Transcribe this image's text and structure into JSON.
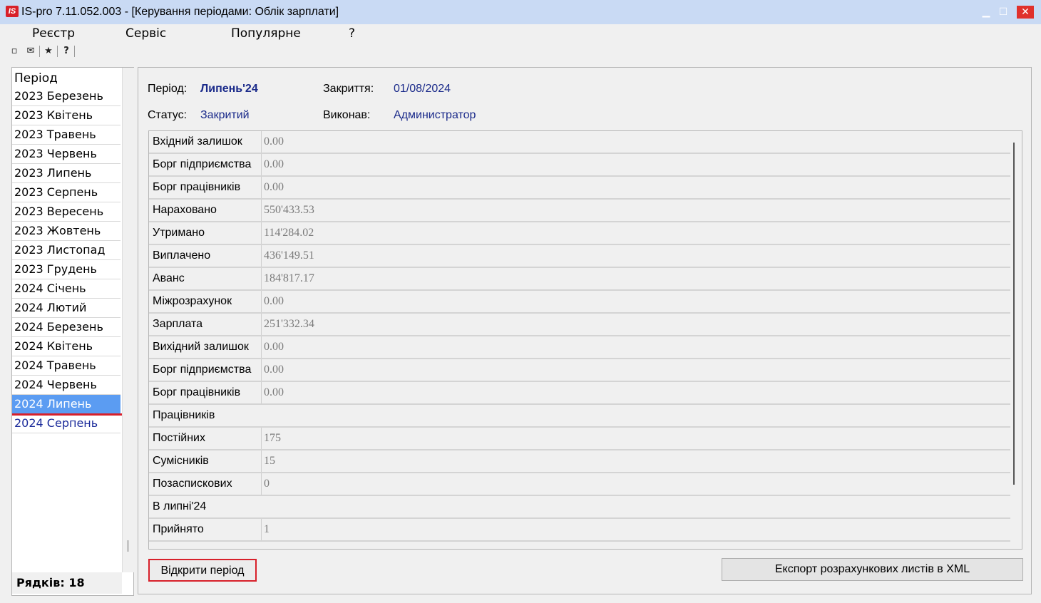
{
  "window": {
    "logo": "IS",
    "title": "IS-pro 7.11.052.003 - [Керування періодами: Облік зарплати]",
    "minimize": "▁",
    "maximize": "☐",
    "close": "✕"
  },
  "menu": [
    "Реєстр",
    "Сервіс",
    "Популярне",
    "?"
  ],
  "toolbar": {
    "icons": [
      "document-icon",
      "mail-icon",
      "star-icon",
      "help-icon"
    ],
    "glyphs": [
      "▫",
      "✉",
      "★",
      "?"
    ]
  },
  "periods": {
    "header": "Період",
    "items": [
      "2023 Березень",
      "2023 Квітень",
      "2023 Травень",
      "2023 Червень",
      "2023 Липень",
      "2023 Серпень",
      "2023 Вересень",
      "2023 Жовтень",
      "2023 Листопад",
      "2023 Грудень",
      "2024 Січень",
      "2024 Лютий",
      "2024 Березень",
      "2024 Квітень",
      "2024 Травень",
      "2024 Червень",
      "2024 Липень",
      "2024 Серпень"
    ],
    "selected_index": 16,
    "row_count": "Рядків: 18"
  },
  "details": {
    "period_label": "Період:",
    "period_value": "Липень'24",
    "closing_label": "Закриття:",
    "closing_value": "01/08/2024",
    "status_label": "Статус:",
    "status_value": "Закритий",
    "executor_label": "Виконав:",
    "executor_value": "Администратор"
  },
  "grid": [
    {
      "label": "Вхідний залишок",
      "value": "0.00"
    },
    {
      "label": "Борг підприємства",
      "value": "0.00"
    },
    {
      "label": "Борг працівників",
      "value": "0.00"
    },
    {
      "label": "Нараховано",
      "value": "550'433.53"
    },
    {
      "label": "Утримано",
      "value": "114'284.02"
    },
    {
      "label": "Виплачено",
      "value": "436'149.51"
    },
    {
      "label": "Аванс",
      "value": "184'817.17"
    },
    {
      "label": "Міжрозрахунок",
      "value": "0.00"
    },
    {
      "label": "Зарплата",
      "value": "251'332.34"
    },
    {
      "label": "Вихідний залишок",
      "value": "0.00"
    },
    {
      "label": "Борг підприємства",
      "value": "0.00"
    },
    {
      "label": "Борг працівників",
      "value": "0.00"
    },
    {
      "label": "Працівників",
      "value": null
    },
    {
      "label": "Постійних",
      "value": "175"
    },
    {
      "label": "Сумісників",
      "value": "15"
    },
    {
      "label": "Позаспискових",
      "value": "0"
    },
    {
      "label": "В липні'24",
      "value": null
    },
    {
      "label": "Прийнято",
      "value": "1"
    }
  ],
  "buttons": {
    "open_period": "Відкрити період",
    "export_xml": "Експорт розрахункових листів в XML"
  }
}
